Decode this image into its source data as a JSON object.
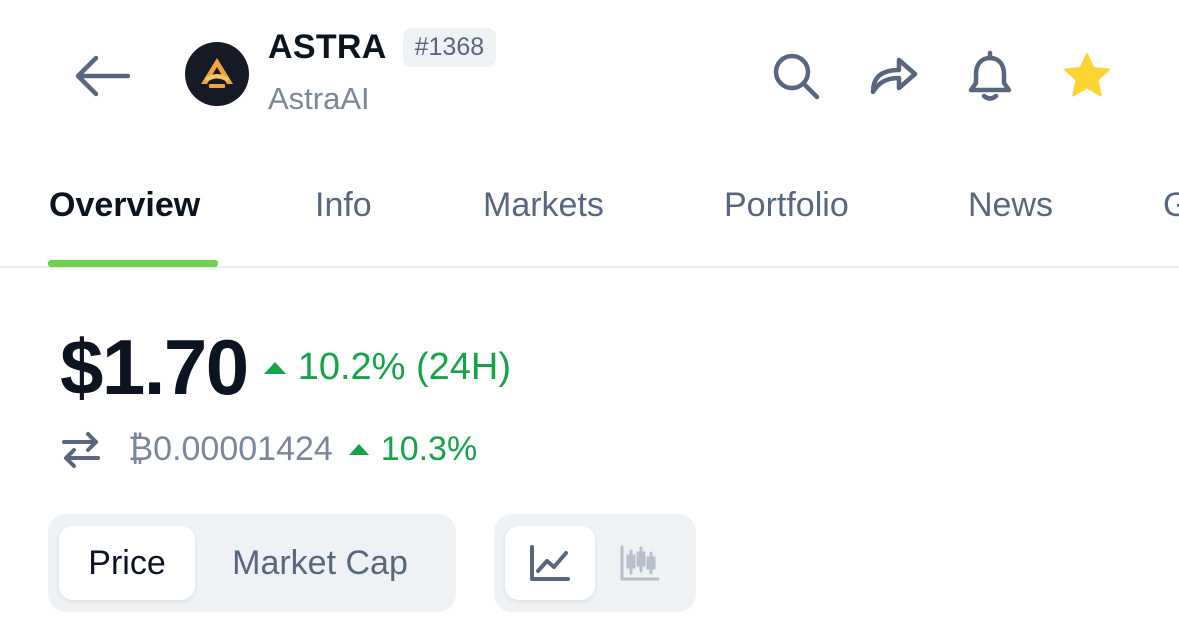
{
  "header": {
    "symbol": "ASTRA",
    "rank": "#1368",
    "name": "AstraAI",
    "icons": [
      "arrow-left-icon",
      "search-icon",
      "share-icon",
      "bell-icon",
      "star-icon"
    ],
    "star_color": "#fcd535"
  },
  "tabs": [
    {
      "label": "Overview",
      "active": true
    },
    {
      "label": "Info"
    },
    {
      "label": "Markets"
    },
    {
      "label": "Portfolio"
    },
    {
      "label": "News"
    },
    {
      "label": "G"
    }
  ],
  "price": {
    "usd": "$1.70",
    "change_24h": "10.2% (24H)",
    "btc": "₿0.00001424",
    "btc_change": "10.3%"
  },
  "chart_controls": {
    "metric_options": [
      "Price",
      "Market Cap"
    ],
    "selected_metric": "Price",
    "chart_types": [
      "line-chart-icon",
      "candlestick-icon"
    ],
    "selected_type": "line-chart-icon"
  },
  "colors": {
    "accent": "#6bd24a",
    "positive": "#16a34a",
    "text_primary": "#0d1421",
    "text_secondary": "#58667e"
  }
}
